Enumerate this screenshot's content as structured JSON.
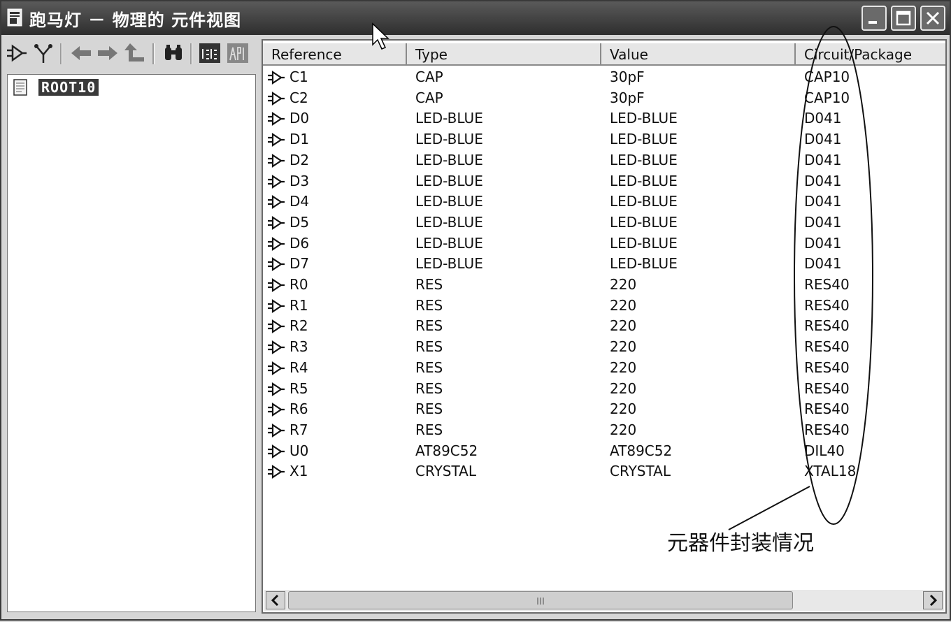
{
  "window": {
    "title": "跑马灯 － 物理的 元件视图"
  },
  "title_buttons": {
    "minimize_icon": "minimize-icon",
    "maximize_icon": "maximize-icon",
    "close_icon": "close-icon"
  },
  "toolbar": {
    "items": [
      "component-icon",
      "net-icon",
      "back-arrow-icon",
      "forward-arrow-icon",
      "up-arrow-icon",
      "binoculars-icon",
      "isis-icon",
      "ares-icon"
    ]
  },
  "tree": {
    "root_label": "ROOT10"
  },
  "table": {
    "columns": [
      "Reference",
      "Type",
      "Value",
      "Circuit/Package"
    ],
    "rows": [
      {
        "ref": "C1",
        "type": "CAP",
        "value": "30pF",
        "package": "CAP10"
      },
      {
        "ref": "C2",
        "type": "CAP",
        "value": "30pF",
        "package": "CAP10"
      },
      {
        "ref": "D0",
        "type": "LED-BLUE",
        "value": "LED-BLUE",
        "package": "D041"
      },
      {
        "ref": "D1",
        "type": "LED-BLUE",
        "value": "LED-BLUE",
        "package": "D041"
      },
      {
        "ref": "D2",
        "type": "LED-BLUE",
        "value": "LED-BLUE",
        "package": "D041"
      },
      {
        "ref": "D3",
        "type": "LED-BLUE",
        "value": "LED-BLUE",
        "package": "D041"
      },
      {
        "ref": "D4",
        "type": "LED-BLUE",
        "value": "LED-BLUE",
        "package": "D041"
      },
      {
        "ref": "D5",
        "type": "LED-BLUE",
        "value": "LED-BLUE",
        "package": "D041"
      },
      {
        "ref": "D6",
        "type": "LED-BLUE",
        "value": "LED-BLUE",
        "package": "D041"
      },
      {
        "ref": "D7",
        "type": "LED-BLUE",
        "value": "LED-BLUE",
        "package": "D041"
      },
      {
        "ref": "R0",
        "type": "RES",
        "value": "220",
        "package": "RES40"
      },
      {
        "ref": "R1",
        "type": "RES",
        "value": "220",
        "package": "RES40"
      },
      {
        "ref": "R2",
        "type": "RES",
        "value": "220",
        "package": "RES40"
      },
      {
        "ref": "R3",
        "type": "RES",
        "value": "220",
        "package": "RES40"
      },
      {
        "ref": "R4",
        "type": "RES",
        "value": "220",
        "package": "RES40"
      },
      {
        "ref": "R5",
        "type": "RES",
        "value": "220",
        "package": "RES40"
      },
      {
        "ref": "R6",
        "type": "RES",
        "value": "220",
        "package": "RES40"
      },
      {
        "ref": "R7",
        "type": "RES",
        "value": "220",
        "package": "RES40"
      },
      {
        "ref": "U0",
        "type": "AT89C52",
        "value": "AT89C52",
        "package": "DIL40"
      },
      {
        "ref": "X1",
        "type": "CRYSTAL",
        "value": "CRYSTAL",
        "package": "XTAL18"
      }
    ]
  },
  "annotation": {
    "text": "元器件封装情况"
  }
}
